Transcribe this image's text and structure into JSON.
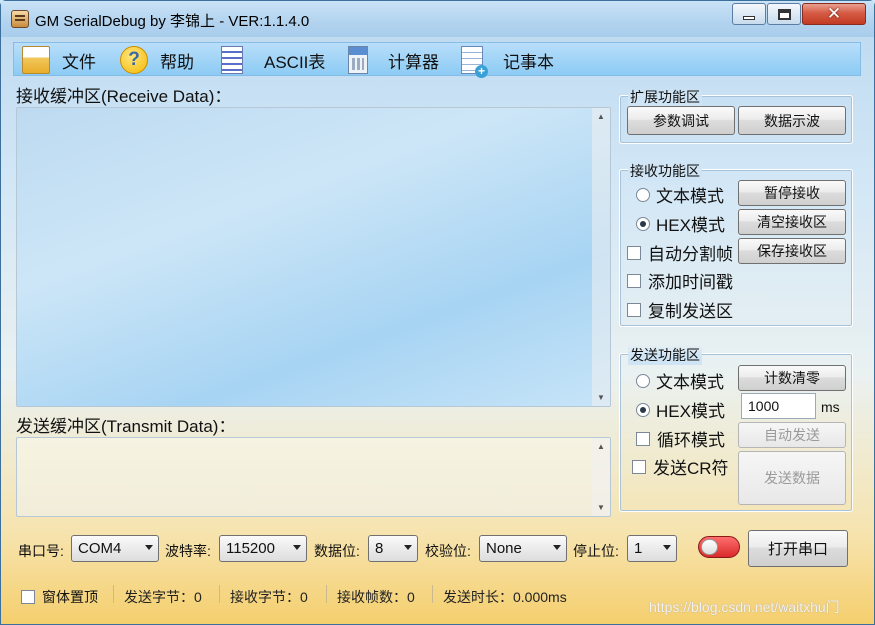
{
  "window": {
    "title": "GM SerialDebug by 李锦上 - VER:1.1.4.0",
    "controls": {
      "minimize": "minimize-icon",
      "maximize": "maximize-icon",
      "close": "close-icon",
      "close_glyph": "✕"
    }
  },
  "menu": {
    "items": [
      {
        "label": "文件",
        "icon": "folder-icon"
      },
      {
        "label": "帮助",
        "icon": "help-icon",
        "glyph": "?"
      },
      {
        "label": "ASCII表",
        "icon": "table-icon"
      },
      {
        "label": "计算器",
        "icon": "calculator-icon"
      },
      {
        "label": "记事本",
        "icon": "notepad-icon"
      }
    ]
  },
  "receive": {
    "label": "接收缓冲区(Receive Data)：",
    "scroll_up": "▲",
    "scroll_down": "▼"
  },
  "transmit": {
    "label": "发送缓冲区(Transmit Data)：",
    "scroll_up": "▲",
    "scroll_down": "▼"
  },
  "ext_group": {
    "title": "扩展功能区",
    "param_button": "参数调试",
    "wave_button": "数据示波"
  },
  "recv_group": {
    "title": "接收功能区",
    "text_mode": "文本模式",
    "text_mode_selected": false,
    "hex_mode": "HEX模式",
    "hex_mode_selected": true,
    "auto_split": "自动分割帧",
    "auto_split_checked": false,
    "add_timestamp": "添加时间戳",
    "add_timestamp_checked": false,
    "copy_send": "复制发送区",
    "copy_send_checked": false,
    "pause_button": "暂停接收",
    "clear_button": "清空接收区",
    "save_button": "保存接收区"
  },
  "send_group": {
    "title": "发送功能区",
    "text_mode": "文本模式",
    "text_mode_selected": false,
    "hex_mode": "HEX模式",
    "hex_mode_selected": true,
    "loop_mode": "循环模式",
    "loop_checked": false,
    "send_cr": "发送CR符",
    "send_cr_checked": false,
    "reset_count_button": "计数清零",
    "interval_value": "1000",
    "interval_unit": "ms",
    "auto_send_button": "自动发送",
    "send_data_button": "发送数据"
  },
  "port_settings": {
    "port_label": "串口号:",
    "port_value": "COM4",
    "baud_label": "波特率:",
    "baud_value": "115200",
    "data_bits_label": "数据位:",
    "data_bits_value": "8",
    "parity_label": "校验位:",
    "parity_value": "None",
    "stop_bits_label": "停止位:",
    "stop_bits_value": "1",
    "open_button": "打开串口",
    "status_color": "#d92a2a"
  },
  "status_bar": {
    "topmost_label": "窗体置顶",
    "topmost_checked": false,
    "sent_bytes": "发送字节：0",
    "recv_bytes": "接收字节：0",
    "recv_frames": "接收帧数：0",
    "send_duration": "发送时长：0.000ms"
  },
  "watermark": "https://blog.csdn.net/waitxhu门"
}
